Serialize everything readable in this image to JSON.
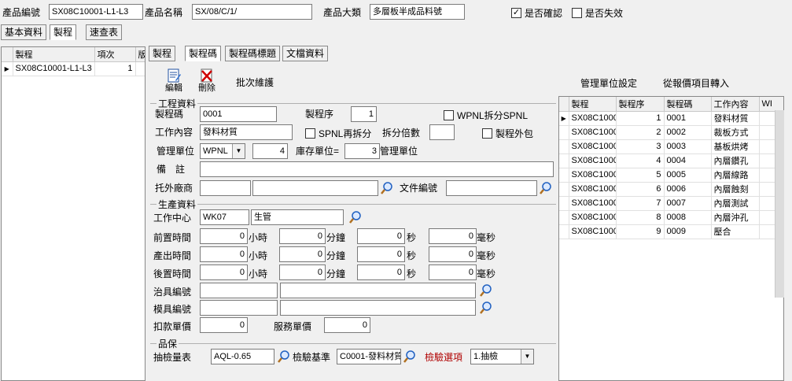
{
  "header": {
    "product_code_label": "產品編號",
    "product_code": "SX08C10001-L1-L3",
    "product_name_label": "產品名稱",
    "product_name": "SX/08/C/1/",
    "category_label": "產品大類",
    "category": "多層板半成品料號",
    "confirmed_label": "是否確認",
    "confirmed_mark": "✓",
    "invalid_label": "是否失效"
  },
  "top_tabs": [
    "基本資料",
    "製程",
    "速查表"
  ],
  "left_grid": {
    "columns": [
      "製程",
      "項次",
      "版"
    ],
    "rows": [
      {
        "process": "SX08C10001-L1-L3",
        "item": "1",
        "ver": ""
      }
    ]
  },
  "inner_tabs": [
    "製程",
    "製程碼",
    "製程碼標題",
    "文檔資料"
  ],
  "toolbar": {
    "edit_label": "編輯",
    "delete_label": "刪除",
    "batch_label": "批次維護",
    "mgmt_unit_setting": "管理單位設定",
    "import_quote": "從報價項目轉入"
  },
  "eng": {
    "group_title": "工程資料",
    "code_label": "製程碼",
    "code": "0001",
    "seq_label": "製程序",
    "seq": "1",
    "wpnl_split_label": "WPNL拆分SPNL",
    "work_label": "工作內容",
    "work": "發料材質",
    "spnl_split_label": "SPNL再拆分",
    "split_mult_label": "拆分倍數",
    "split_mult": "",
    "outsource_label": "製程外包",
    "mgmt_unit_label": "管理單位",
    "mgmt_unit": "WPNL",
    "mgmt_qty": "4",
    "stock_unit_label": "庫存單位=",
    "stock_qty": "3",
    "mgmt_unit_label2": "管理單位",
    "remark_label": "備　註",
    "remark": "",
    "vendor_label": "托外廠商",
    "doc_label": "文件編號"
  },
  "prod": {
    "group_title": "生產資料",
    "center_label": "工作中心",
    "center_code": "WK07",
    "center_name": "生管",
    "rows": [
      {
        "label": "前置時間",
        "h": "0",
        "m": "0",
        "s": "0",
        "ms": "0"
      },
      {
        "label": "產出時間",
        "h": "0",
        "m": "0",
        "s": "0",
        "ms": "0"
      },
      {
        "label": "後置時間",
        "h": "0",
        "m": "0",
        "s": "0",
        "ms": "0"
      }
    ],
    "unit_h": "小時",
    "unit_m": "分鐘",
    "unit_s": "秒",
    "unit_ms": "毫秒",
    "jig_label": "治具編號",
    "mold_label": "模具編號",
    "deduct_label": "扣款單價",
    "deduct": "0",
    "service_label": "服務單價",
    "service": "0"
  },
  "qa": {
    "group_title": "品保",
    "sample_label": "抽檢量表",
    "sample": "AQL-0.65",
    "basis_label": "檢驗基準",
    "basis": "C0001-發料材質",
    "option_label": "檢驗選項",
    "option": "1.抽檢"
  },
  "right_grid": {
    "columns": [
      "製程",
      "製程序",
      "製程碼",
      "工作內容",
      "WI"
    ],
    "rows": [
      {
        "p": "SX08C1000",
        "seq": "1",
        "code": "0001",
        "work": "發料材質"
      },
      {
        "p": "SX08C1000",
        "seq": "2",
        "code": "0002",
        "work": "裁板方式"
      },
      {
        "p": "SX08C1000",
        "seq": "3",
        "code": "0003",
        "work": "基板烘烤"
      },
      {
        "p": "SX08C1000",
        "seq": "4",
        "code": "0004",
        "work": "內層鑽孔"
      },
      {
        "p": "SX08C1000",
        "seq": "5",
        "code": "0005",
        "work": "內層線路"
      },
      {
        "p": "SX08C1000",
        "seq": "6",
        "code": "0006",
        "work": "內層蝕刻"
      },
      {
        "p": "SX08C1000",
        "seq": "7",
        "code": "0007",
        "work": "內層測試"
      },
      {
        "p": "SX08C1000",
        "seq": "8",
        "code": "0008",
        "work": "內層沖孔"
      },
      {
        "p": "SX08C1000",
        "seq": "9",
        "code": "0009",
        "work": "壓合"
      }
    ]
  }
}
